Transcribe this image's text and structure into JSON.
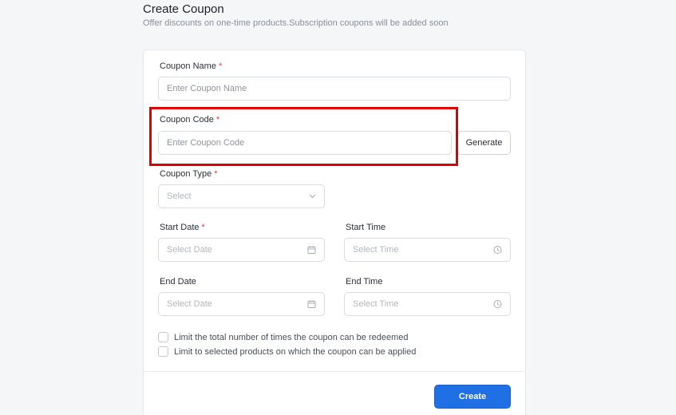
{
  "header": {
    "title": "Create Coupon",
    "subtitle": "Offer discounts on one-time products.Subscription coupons will be added soon"
  },
  "form": {
    "required_mark": "*",
    "coupon_name": {
      "label": "Coupon Name",
      "placeholder": "Enter Coupon Name"
    },
    "coupon_code": {
      "label": "Coupon Code",
      "placeholder": "Enter Coupon Code",
      "generate_label": "Generate"
    },
    "coupon_type": {
      "label": "Coupon Type",
      "placeholder": "Select"
    },
    "start_date": {
      "label": "Start Date",
      "placeholder": "Select Date"
    },
    "start_time": {
      "label": "Start Time",
      "placeholder": "Select Time"
    },
    "end_date": {
      "label": "End Date",
      "placeholder": "Select Date"
    },
    "end_time": {
      "label": "End Time",
      "placeholder": "Select Time"
    },
    "checkboxes": [
      {
        "label": "Limit the total number of times the coupon can be redeemed",
        "checked": false
      },
      {
        "label": "Limit to selected products on which the coupon can be applied",
        "checked": false
      }
    ],
    "create_label": "Create"
  },
  "colors": {
    "primary": "#1f6fe5",
    "required": "#e23b3b",
    "highlight": "#e00000"
  },
  "icons": {
    "select": "chevron-down-icon",
    "date": "calendar-icon",
    "time": "clock-icon"
  }
}
